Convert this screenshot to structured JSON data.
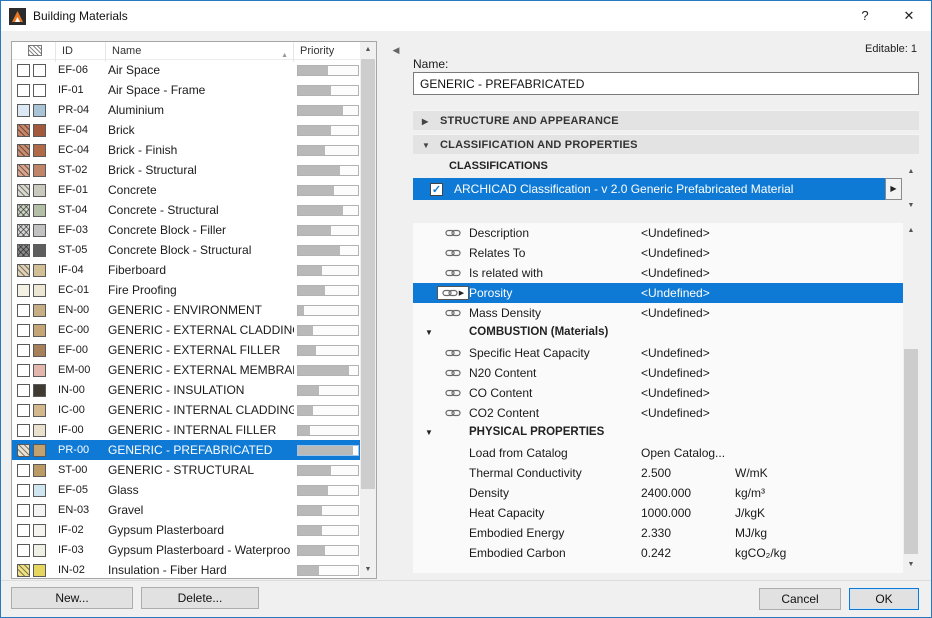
{
  "window": {
    "title": "Building Materials",
    "help_label": "?",
    "close_label": "✕"
  },
  "colors": {
    "selection": "#0e7ad6",
    "window_border": "#2878be",
    "priority_fill": "#b9b9b9"
  },
  "left_panel": {
    "columns": {
      "id": "ID",
      "name": "Name",
      "priority": "Priority"
    },
    "selected_id": "PR-00",
    "rows": [
      {
        "id": "EF-06",
        "name": "Air Space",
        "priority": 50,
        "fill": {
          "c": "#ffffff",
          "p": "none"
        },
        "surface": "#ffffff"
      },
      {
        "id": "IF-01",
        "name": "Air Space - Frame",
        "priority": 55,
        "fill": {
          "c": "#ffffff",
          "p": "none"
        },
        "surface": "#ffffff"
      },
      {
        "id": "PR-04",
        "name": "Aluminium",
        "priority": 75,
        "fill": {
          "c": "#dce9f5",
          "p": "none"
        },
        "surface": "#a9c4d6"
      },
      {
        "id": "EF-04",
        "name": "Brick",
        "priority": 55,
        "fill": {
          "c": "#c9876a",
          "p": "diag"
        },
        "surface": "#a2593c"
      },
      {
        "id": "EC-04",
        "name": "Brick - Finish",
        "priority": 45,
        "fill": {
          "c": "#c98c6e",
          "p": "diag"
        },
        "surface": "#b06a48"
      },
      {
        "id": "ST-02",
        "name": "Brick - Structural",
        "priority": 70,
        "fill": {
          "c": "#d9a58e",
          "p": "diag"
        },
        "surface": "#c08468"
      },
      {
        "id": "EF-01",
        "name": "Concrete",
        "priority": 60,
        "fill": {
          "c": "#d9d9d0",
          "p": "diag"
        },
        "surface": "#c9c9bd"
      },
      {
        "id": "ST-04",
        "name": "Concrete - Structural",
        "priority": 75,
        "fill": {
          "c": "#ccd2c4",
          "p": "cross"
        },
        "surface": "#b4bfa8"
      },
      {
        "id": "EF-03",
        "name": "Concrete Block - Filler",
        "priority": 55,
        "fill": {
          "c": "#d6d6d6",
          "p": "cross"
        },
        "surface": "#c2c2c2"
      },
      {
        "id": "ST-05",
        "name": "Concrete Block - Structural",
        "priority": 70,
        "fill": {
          "c": "#8a8a8a",
          "p": "cross"
        },
        "surface": "#5e5e5e"
      },
      {
        "id": "IF-04",
        "name": "Fiberboard",
        "priority": 40,
        "fill": {
          "c": "#e0d2b4",
          "p": "diag"
        },
        "surface": "#d2bf96"
      },
      {
        "id": "EC-01",
        "name": "Fire Proofing",
        "priority": 45,
        "fill": {
          "c": "#f4f0e4",
          "p": "none"
        },
        "surface": "#ece6d4"
      },
      {
        "id": "EN-00",
        "name": "GENERIC - ENVIRONMENT",
        "priority": 10,
        "fill": {
          "c": "#ffffff",
          "p": "none"
        },
        "surface": "#c7ae85"
      },
      {
        "id": "EC-00",
        "name": "GENERIC - EXTERNAL CLADDING",
        "priority": 25,
        "fill": {
          "c": "#ffffff",
          "p": "none"
        },
        "surface": "#c6a677"
      },
      {
        "id": "EF-00",
        "name": "GENERIC - EXTERNAL FILLER",
        "priority": 30,
        "fill": {
          "c": "#ffffff",
          "p": "none"
        },
        "surface": "#a8815a"
      },
      {
        "id": "EM-00",
        "name": "GENERIC - EXTERNAL MEMBRANE",
        "priority": 85,
        "fill": {
          "c": "#ffffff",
          "p": "none"
        },
        "surface": "#e3b7ae"
      },
      {
        "id": "IN-00",
        "name": "GENERIC - INSULATION",
        "priority": 35,
        "fill": {
          "c": "#ffffff",
          "p": "none"
        },
        "surface": "#3f3a32"
      },
      {
        "id": "IC-00",
        "name": "GENERIC - INTERNAL CLADDING",
        "priority": 25,
        "fill": {
          "c": "#ffffff",
          "p": "none"
        },
        "surface": "#d3b88e"
      },
      {
        "id": "IF-00",
        "name": "GENERIC - INTERNAL FILLER",
        "priority": 20,
        "fill": {
          "c": "#ffffff",
          "p": "none"
        },
        "surface": "#e9e0cd"
      },
      {
        "id": "PR-00",
        "name": "GENERIC - PREFABRICATED",
        "priority": 92,
        "fill": {
          "c": "#e9e2d2",
          "p": "diag"
        },
        "surface": "#c2a271"
      },
      {
        "id": "ST-00",
        "name": "GENERIC - STRUCTURAL",
        "priority": 55,
        "fill": {
          "c": "#ffffff",
          "p": "none"
        },
        "surface": "#bb9a66"
      },
      {
        "id": "EF-05",
        "name": "Glass",
        "priority": 50,
        "fill": {
          "c": "#ffffff",
          "p": "none"
        },
        "surface": "#cfe6f1"
      },
      {
        "id": "EN-03",
        "name": "Gravel",
        "priority": 40,
        "fill": {
          "c": "#ffffff",
          "p": "none"
        },
        "surface": "#f4f4f4"
      },
      {
        "id": "IF-02",
        "name": "Gypsum Plasterboard",
        "priority": 40,
        "fill": {
          "c": "#ffffff",
          "p": "none"
        },
        "surface": "#f6f4ee"
      },
      {
        "id": "IF-03",
        "name": "Gypsum Plasterboard - Waterproo",
        "priority": 45,
        "fill": {
          "c": "#ffffff",
          "p": "none"
        },
        "surface": "#eef0e6"
      },
      {
        "id": "IN-02",
        "name": "Insulation - Fiber Hard",
        "priority": 35,
        "fill": {
          "c": "#efe084",
          "p": "diag"
        },
        "surface": "#e6d55e"
      }
    ],
    "new_button": "New...",
    "delete_button": "Delete..."
  },
  "right_panel": {
    "editable_label": "Editable: 1",
    "name_label": "Name:",
    "name_value": "GENERIC - PREFABRICATED",
    "sections": {
      "structure": "STRUCTURE AND APPEARANCE",
      "classification": "CLASSIFICATION AND PROPERTIES"
    },
    "classifications": {
      "header": "CLASSIFICATIONS",
      "selected_item": "ARCHICAD Classification - v 2.0 Generic Prefabricated Material"
    },
    "properties": [
      {
        "type": "prop",
        "linked": true,
        "label": "Description",
        "value": "<Undefined>"
      },
      {
        "type": "prop",
        "linked": true,
        "label": "Relates To",
        "value": "<Undefined>"
      },
      {
        "type": "prop",
        "linked": true,
        "label": "Is related with",
        "value": "<Undefined>"
      },
      {
        "type": "prop",
        "linked": true,
        "selected": true,
        "label": "Porosity",
        "value": "<Undefined>"
      },
      {
        "type": "prop",
        "linked": true,
        "label": "Mass Density",
        "value": "<Undefined>"
      },
      {
        "type": "group",
        "label": "COMBUSTION (Materials)"
      },
      {
        "type": "prop",
        "linked": true,
        "label": "Specific Heat Capacity",
        "value": "<Undefined>"
      },
      {
        "type": "prop",
        "linked": true,
        "label": "N20 Content",
        "value": "<Undefined>"
      },
      {
        "type": "prop",
        "linked": true,
        "label": "CO Content",
        "value": "<Undefined>"
      },
      {
        "type": "prop",
        "linked": true,
        "label": "CO2 Content",
        "value": "<Undefined>"
      },
      {
        "type": "group",
        "label": "PHYSICAL PROPERTIES"
      },
      {
        "type": "prop",
        "linked": false,
        "label": "Load from Catalog",
        "value": "Open Catalog..."
      },
      {
        "type": "prop",
        "linked": false,
        "label": "Thermal Conductivity",
        "value": "2.500",
        "unit": "W/mK"
      },
      {
        "type": "prop",
        "linked": false,
        "label": "Density",
        "value": "2400.000",
        "unit": "kg/m³"
      },
      {
        "type": "prop",
        "linked": false,
        "label": "Heat Capacity",
        "value": "1000.000",
        "unit": "J/kgK"
      },
      {
        "type": "prop",
        "linked": false,
        "label": "Embodied Energy",
        "value": "2.330",
        "unit": "MJ/kg"
      },
      {
        "type": "prop",
        "linked": false,
        "label": "Embodied Carbon",
        "value": "0.242",
        "unit": "kgCO₂/kg"
      }
    ],
    "cancel_button": "Cancel",
    "ok_button": "OK"
  }
}
